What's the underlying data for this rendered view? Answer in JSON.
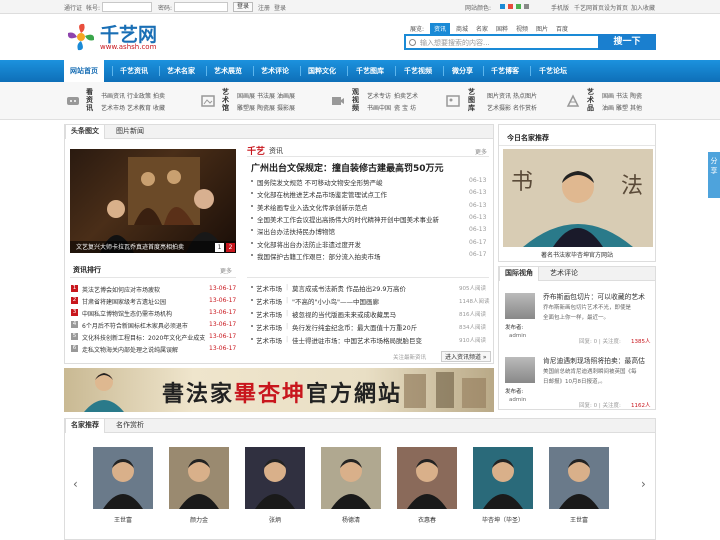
{
  "topbar": {
    "login_label": "通行证",
    "user_label": "帐号:",
    "pass_label": "密码:",
    "login_btn": "登录",
    "register": "注册",
    "signin": "登录",
    "color_label": "网站颜色:",
    "mobile": "手机版",
    "home_link": "千艺网首页",
    "set_home": "设为首页",
    "favorite": "加入收藏",
    "swatches": [
      "#1a8ad6",
      "#e64a3b",
      "#4caf50",
      "#888888"
    ]
  },
  "header": {
    "logo_text": "千艺网",
    "logo_url": "www.ashsh.com",
    "search_tabs": [
      "展览:",
      "资讯",
      "商城",
      "名家",
      "国粹",
      "视频",
      "图片",
      "百度"
    ],
    "search_placeholder": "输入想要搜索的内容...",
    "search_btn": "搜一下"
  },
  "nav": {
    "items": [
      "网站首页",
      "千艺资讯",
      "艺术名家",
      "艺术展览",
      "艺术评论",
      "国粹文化",
      "千艺图库",
      "千艺视频",
      "微分享",
      "千艺博客",
      "千艺论坛"
    ]
  },
  "subnav": [
    {
      "title": "看资讯",
      "icon": "news-icon",
      "links": [
        "书画资讯",
        "行业政策",
        "拍卖",
        "艺术市场",
        "艺术教育",
        "收藏"
      ]
    },
    {
      "title": "艺术馆",
      "icon": "gallery-icon",
      "links": [
        "国画展",
        "书法展",
        "油画展",
        "雕塑展",
        "陶瓷展",
        "摄影展"
      ]
    },
    {
      "title": "观视频",
      "icon": "video-icon",
      "links": [
        "艺术专访",
        "拍卖艺术",
        "书画中国",
        "瓷",
        "宝",
        "坊"
      ]
    },
    {
      "title": "艺图库",
      "icon": "image-icon",
      "links": [
        "图片资讯",
        "热点图片",
        "艺术摄影",
        "名作赏析"
      ]
    },
    {
      "title": "艺术品",
      "icon": "art-icon",
      "links": [
        "国画",
        "书法",
        "陶瓷",
        "油画",
        "雕塑",
        "其他"
      ]
    }
  ],
  "headline": {
    "tabs": [
      "头条图文",
      "图片新闻"
    ],
    "photo_caption": "文艺复兴大师卡拉瓦乔真迹首度亮相拍卖",
    "pages": [
      "1",
      "2"
    ],
    "section_brand": "千艺",
    "section_name": "资讯",
    "more": "更多",
    "top_title": "广州出台文保规定：撞自装修古建最高罚50万元",
    "items": [
      {
        "t": "国务院发文规范 不可移动文物安全形势严峻",
        "d": "06-13"
      },
      {
        "t": "文化部在杭推进艺术品市场鉴定管理试点工作",
        "d": "06-13"
      },
      {
        "t": "美术绘画专业入选文化传承创新示范点",
        "d": "06-13"
      },
      {
        "t": "全国美术工作会议提出高扬伟大的时代精神开创中国美术事业新",
        "d": "06-13"
      },
      {
        "t": "深出台办法扶持民办博物馆",
        "d": "06-13"
      },
      {
        "t": "文化部将出台办法防止非遗过度开发",
        "d": "06-17"
      },
      {
        "t": "我国保护古籍工作艰巨：部分流入拍卖市场",
        "d": "06-17"
      }
    ]
  },
  "ranking": {
    "title": "资讯排行",
    "more": "更多",
    "items": [
      {
        "t": "英法艺博会如何应对市场疲软",
        "d": "13-06-17"
      },
      {
        "t": "甘肃省将建国家级考古遗址公园",
        "d": "13-06-17"
      },
      {
        "t": "中国私立博物馆生态仍需市场机构",
        "d": "13-06-17"
      },
      {
        "t": "6个月后不符合新国标杠木家具必须退市",
        "d": "13-06-17"
      },
      {
        "t": "文化科技创新工程目标：2020年文化产业成支",
        "d": "13-06-17"
      },
      {
        "t": "走私文物海关内部处理之说纯属误解",
        "d": "13-06-17"
      }
    ]
  },
  "hotlist": {
    "footer": "进入资讯频道 »",
    "tags": "关注最新资讯",
    "items": [
      {
        "c": "艺术市场",
        "t": "莫言成或书法新贵 作品拍出29.9万高价",
        "n": "905人阅读"
      },
      {
        "c": "艺术市场",
        "t": "\"不高的\"小小鸟\"——中国画廊",
        "n": "1148人阅读"
      },
      {
        "c": "艺术市场",
        "t": "被忽视的当代版画未来或成收藏黑马",
        "n": "816人阅读"
      },
      {
        "c": "艺术市场",
        "t": "奂行发行纯金纪念币：最大面值十万重20斤",
        "n": "834人阅读"
      },
      {
        "c": "艺术市场",
        "t": "佳士得进驻市场：中国艺术市场格局脱胎巨变",
        "n": "910人阅读"
      }
    ]
  },
  "recommend": {
    "title": "今日名家推荐",
    "caption": "著名书法家毕杏坤官方网站"
  },
  "comments": {
    "tabs": [
      "国际视角",
      "艺术评论"
    ],
    "publisher_label": "发布者:",
    "items": [
      {
        "t": "乔布斯画包切片：可以收藏的艺术",
        "s": [
          "乔布斯新画包切片艺术不光，即使是",
          "全面包上你一样，最近一。"
        ],
        "by": "admin",
        "stats": "回复: 0 | 关注度:",
        "count": "1385人"
      },
      {
        "t": "肯尼迪遇刺现场照将拍卖：最高估",
        "s": [
          "美国前总统肯尼迪遇刺瞬间被英国《每",
          "日邮报》10月8日报道，。"
        ],
        "by": "admin",
        "stats": "回复: 0 | 关注度:",
        "count": "1162人"
      }
    ]
  },
  "banner": {
    "pre": "書法家",
    "name": "畢杏坤",
    "post": "官方網站"
  },
  "masters": {
    "tabs": [
      "名家推荐",
      "名作赏析"
    ],
    "names": [
      "王世富",
      "颜力金",
      "张炳",
      "杨德清",
      "衣惠春",
      "毕杏坤（毕圣）",
      "王世富"
    ]
  },
  "share": {
    "label": "分享"
  }
}
